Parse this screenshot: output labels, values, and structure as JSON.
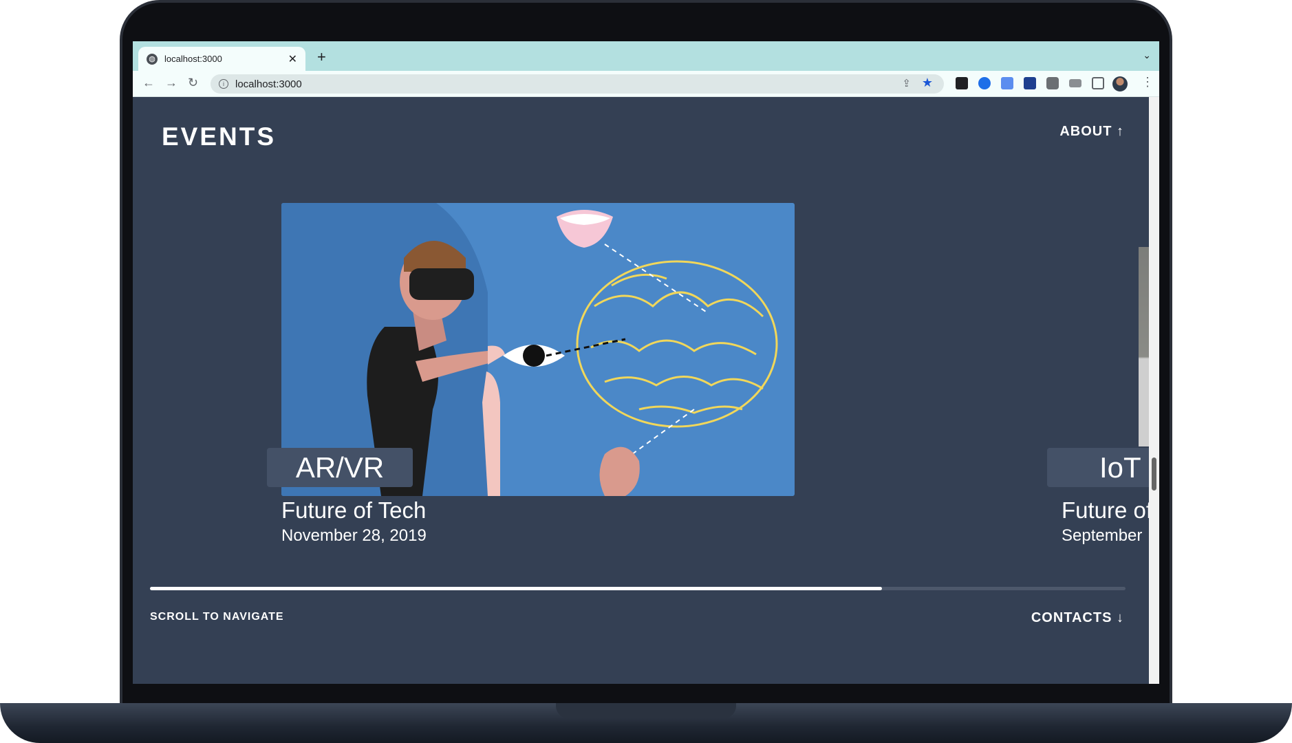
{
  "browser": {
    "tab_title": "localhost:3000",
    "url": "localhost:3000",
    "new_tab_icon": "plus-icon",
    "tab_close_icon": "close-icon"
  },
  "header": {
    "title": "EVENTS",
    "about_label": "ABOUT ↑"
  },
  "cards": [
    {
      "tag": "AR/VR",
      "title": "Future of Tech",
      "date": "November 28, 2019"
    },
    {
      "tag": "IoT",
      "title": "Future of",
      "date": "September"
    }
  ],
  "footer": {
    "scroll_hint": "SCROLL TO NAVIGATE",
    "contacts_label": "CONTACTS ↓",
    "progress": 0.75
  },
  "colors": {
    "page_bg": "#344054",
    "tag_bg": "#445167",
    "image_bg": "#4b88c8",
    "brain_stroke": "#f1d75a"
  }
}
